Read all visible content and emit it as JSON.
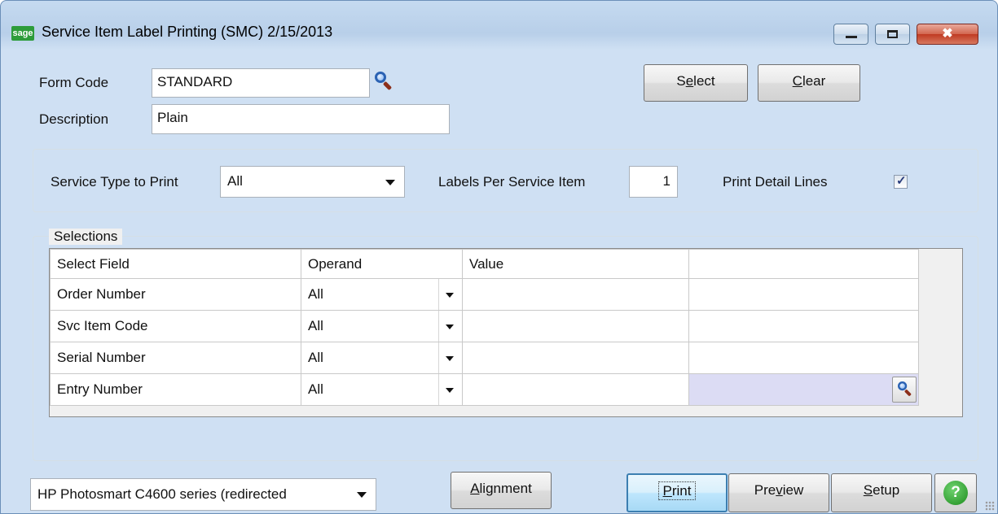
{
  "window": {
    "app_badge": "sage",
    "title": "Service Item Label Printing (SMC) 2/15/2013",
    "close_glyph": "✖"
  },
  "form": {
    "form_code_label": "Form Code",
    "form_code_value": "STANDARD",
    "description_label": "Description",
    "description_value": "Plain"
  },
  "buttons": {
    "select_pre": "S",
    "select_u": "e",
    "select_post": "lect",
    "clear_u": "C",
    "clear_post": "lear",
    "alignment_u": "A",
    "alignment_post": "lignment",
    "print_u": "P",
    "print_post": "rint",
    "preview_pre": "Pre",
    "preview_u": "v",
    "preview_post": "iew",
    "setup_u": "S",
    "setup_post": "etup",
    "help": "?"
  },
  "options": {
    "service_type_label": "Service Type to Print",
    "service_type_value": "All",
    "labels_per_item_label": "Labels Per Service Item",
    "labels_per_item_value": "1",
    "print_detail_lines_label": "Print Detail Lines",
    "print_detail_lines_checked": true,
    "check_glyph": "✓"
  },
  "selections": {
    "group_label": "Selections",
    "columns": [
      "Select Field",
      "Operand",
      "Value",
      ""
    ],
    "rows": [
      {
        "field": "Order Number",
        "operand": "All",
        "value": "",
        "value2": ""
      },
      {
        "field": "Svc Item Code",
        "operand": "All",
        "value": "",
        "value2": ""
      },
      {
        "field": "Serial Number",
        "operand": "All",
        "value": "",
        "value2": ""
      },
      {
        "field": "Entry Number",
        "operand": "All",
        "value": "",
        "value2": ""
      }
    ]
  },
  "printer": {
    "selected": "HP Photosmart C4600 series (redirected"
  }
}
